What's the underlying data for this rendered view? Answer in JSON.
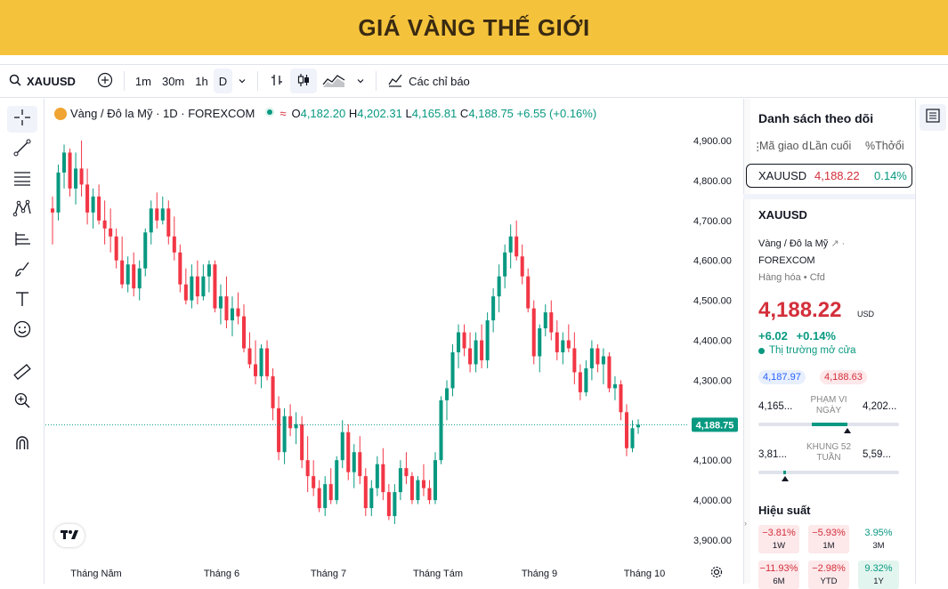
{
  "banner": {
    "title": "GIÁ VÀNG THẾ GIỚI"
  },
  "toolbar": {
    "symbol": "XAUUSD",
    "intervals": [
      "1m",
      "30m",
      "1h",
      "D"
    ],
    "active_interval": "D",
    "indicators_label": "Các chỉ báo"
  },
  "legend": {
    "title": "Vàng / Đô la Mỹ · 1D · FOREXCOM",
    "o_label": "O",
    "o": "4,182.20",
    "h_label": "H",
    "h": "4,202.31",
    "l_label": "L",
    "l": "4,165.81",
    "c_label": "C",
    "c": "4,188.75",
    "change": "+6.55 (+0.16%)"
  },
  "chart_data": {
    "type": "candlestick",
    "y_ticks": [
      "4,900.00",
      "4,800.00",
      "4,700.00",
      "4,600.00",
      "4,500.00",
      "4,400.00",
      "4,300.00",
      "4,100.00",
      "4,000.00",
      "3,900.00"
    ],
    "ylim": [
      3880,
      4935
    ],
    "x_labels": [
      "Tháng Năm",
      "Tháng 6",
      "Tháng 7",
      "Tháng Tám",
      "Tháng 9",
      "Tháng 10"
    ],
    "last_price": 4188.75,
    "last_price_label": "4,188.75",
    "up_color": "#089981",
    "down_color": "#F23645",
    "candles": [
      [
        4730,
        4760,
        4640,
        4720
      ],
      [
        4720,
        4840,
        4700,
        4820
      ],
      [
        4820,
        4890,
        4780,
        4870
      ],
      [
        4870,
        4880,
        4760,
        4780
      ],
      [
        4780,
        4870,
        4740,
        4830
      ],
      [
        4830,
        4900,
        4760,
        4790
      ],
      [
        4790,
        4830,
        4690,
        4720
      ],
      [
        4720,
        4780,
        4680,
        4760
      ],
      [
        4760,
        4790,
        4690,
        4700
      ],
      [
        4700,
        4750,
        4640,
        4680
      ],
      [
        4680,
        4730,
        4620,
        4660
      ],
      [
        4660,
        4680,
        4580,
        4600
      ],
      [
        4600,
        4660,
        4530,
        4540
      ],
      [
        4540,
        4610,
        4520,
        4590
      ],
      [
        4590,
        4620,
        4510,
        4530
      ],
      [
        4530,
        4600,
        4500,
        4580
      ],
      [
        4580,
        4680,
        4560,
        4670
      ],
      [
        4670,
        4750,
        4640,
        4730
      ],
      [
        4730,
        4770,
        4680,
        4700
      ],
      [
        4700,
        4760,
        4690,
        4730
      ],
      [
        4730,
        4750,
        4640,
        4660
      ],
      [
        4660,
        4710,
        4600,
        4620
      ],
      [
        4620,
        4640,
        4520,
        4540
      ],
      [
        4540,
        4580,
        4490,
        4500
      ],
      [
        4500,
        4590,
        4480,
        4560
      ],
      [
        4560,
        4600,
        4490,
        4510
      ],
      [
        4510,
        4590,
        4500,
        4560
      ],
      [
        4560,
        4600,
        4520,
        4590
      ],
      [
        4590,
        4600,
        4470,
        4480
      ],
      [
        4480,
        4540,
        4440,
        4510
      ],
      [
        4510,
        4560,
        4430,
        4450
      ],
      [
        4450,
        4510,
        4410,
        4480
      ],
      [
        4480,
        4520,
        4440,
        4460
      ],
      [
        4460,
        4490,
        4370,
        4380
      ],
      [
        4380,
        4420,
        4330,
        4340
      ],
      [
        4340,
        4400,
        4290,
        4310
      ],
      [
        4310,
        4390,
        4280,
        4380
      ],
      [
        4380,
        4400,
        4300,
        4310
      ],
      [
        4310,
        4330,
        4200,
        4230
      ],
      [
        4230,
        4260,
        4100,
        4120
      ],
      [
        4120,
        4230,
        4090,
        4210
      ],
      [
        4210,
        4240,
        4160,
        4180
      ],
      [
        4180,
        4220,
        4140,
        4190
      ],
      [
        4190,
        4210,
        4080,
        4100
      ],
      [
        4100,
        4160,
        4020,
        4060
      ],
      [
        4060,
        4100,
        4010,
        4030
      ],
      [
        4030,
        4050,
        3970,
        3980
      ],
      [
        3980,
        4060,
        3960,
        4040
      ],
      [
        4040,
        4080,
        3990,
        4000
      ],
      [
        4000,
        4110,
        3990,
        4100
      ],
      [
        4100,
        4200,
        4080,
        4170
      ],
      [
        4170,
        4190,
        4050,
        4070
      ],
      [
        4070,
        4140,
        4030,
        4120
      ],
      [
        4120,
        4160,
        4040,
        4060
      ],
      [
        4060,
        4080,
        3960,
        3980
      ],
      [
        3980,
        4050,
        3960,
        4030
      ],
      [
        4030,
        4110,
        4010,
        4090
      ],
      [
        4090,
        4130,
        4000,
        4020
      ],
      [
        4020,
        4040,
        3950,
        3960
      ],
      [
        3960,
        4040,
        3940,
        4020
      ],
      [
        4020,
        4100,
        4000,
        4080
      ],
      [
        4080,
        4120,
        4040,
        4060
      ],
      [
        4060,
        4070,
        3990,
        4000
      ],
      [
        4000,
        4060,
        3990,
        4050
      ],
      [
        4050,
        4090,
        4010,
        4030
      ],
      [
        4030,
        4050,
        3990,
        4000
      ],
      [
        4000,
        4120,
        3990,
        4100
      ],
      [
        4100,
        4260,
        4090,
        4250
      ],
      [
        4250,
        4300,
        4200,
        4280
      ],
      [
        4280,
        4390,
        4260,
        4370
      ],
      [
        4370,
        4440,
        4330,
        4420
      ],
      [
        4420,
        4440,
        4360,
        4380
      ],
      [
        4380,
        4420,
        4320,
        4340
      ],
      [
        4340,
        4420,
        4320,
        4400
      ],
      [
        4400,
        4440,
        4330,
        4350
      ],
      [
        4350,
        4470,
        4330,
        4450
      ],
      [
        4450,
        4530,
        4420,
        4510
      ],
      [
        4510,
        4590,
        4470,
        4560
      ],
      [
        4560,
        4640,
        4530,
        4620
      ],
      [
        4620,
        4690,
        4580,
        4660
      ],
      [
        4660,
        4700,
        4600,
        4610
      ],
      [
        4610,
        4640,
        4540,
        4560
      ],
      [
        4560,
        4580,
        4470,
        4480
      ],
      [
        4480,
        4500,
        4340,
        4360
      ],
      [
        4360,
        4440,
        4320,
        4430
      ],
      [
        4430,
        4490,
        4410,
        4470
      ],
      [
        4470,
        4500,
        4400,
        4420
      ],
      [
        4420,
        4450,
        4350,
        4370
      ],
      [
        4370,
        4420,
        4340,
        4400
      ],
      [
        4400,
        4440,
        4370,
        4380
      ],
      [
        4380,
        4420,
        4290,
        4320
      ],
      [
        4320,
        4340,
        4250,
        4270
      ],
      [
        4270,
        4350,
        4260,
        4330
      ],
      [
        4330,
        4400,
        4300,
        4380
      ],
      [
        4380,
        4390,
        4320,
        4340
      ],
      [
        4340,
        4380,
        4290,
        4360
      ],
      [
        4360,
        4370,
        4270,
        4280
      ],
      [
        4280,
        4310,
        4250,
        4290
      ],
      [
        4290,
        4300,
        4200,
        4220
      ],
      [
        4220,
        4240,
        4110,
        4130
      ],
      [
        4130,
        4200,
        4120,
        4180
      ],
      [
        4182.2,
        4202.31,
        4165.81,
        4188.75
      ]
    ]
  },
  "watchlist": {
    "title": "Danh sách theo dõi",
    "col_symbol": "Mã giao d",
    "col_last": "Lần cuối",
    "col_change": "%Thởổi",
    "row": {
      "symbol": "XAUUSD",
      "last": "4,188.22",
      "change": "0.14%"
    }
  },
  "details": {
    "symbol": "XAUUSD",
    "name": "Vàng / Đô la Mỹ",
    "exchange": "FOREXCOM",
    "category": "Hàng hóa",
    "type": "Cfd",
    "price": "4,188.22",
    "currency": "USD",
    "change": "+6.02",
    "change_pct": "+0.14%",
    "market_status": "Thị trường mở cửa",
    "bid": "4,187.97",
    "ask": "4,188.63",
    "day_low": "4,165...",
    "day_high": "4,202...",
    "day_range_label_1": "PHẠM VI",
    "day_range_label_2": "NGÀY",
    "day_range_position": 0.63,
    "wk_low": "3,81...",
    "wk_high": "5,59...",
    "wk_range_label_1": "KHUNG 52",
    "wk_range_label_2": "TUẦN",
    "wk_range_position": 0.19
  },
  "performance": {
    "title": "Hiệu suất",
    "items": [
      {
        "value": "−3.81%",
        "period": "1W"
      },
      {
        "value": "−5.93%",
        "period": "1M"
      },
      {
        "value": "3.95%",
        "period": "3M"
      },
      {
        "value": "−11.93%",
        "period": "6M"
      },
      {
        "value": "−2.98%",
        "period": "YTD"
      },
      {
        "value": "9.32%",
        "period": "1Y"
      }
    ]
  }
}
